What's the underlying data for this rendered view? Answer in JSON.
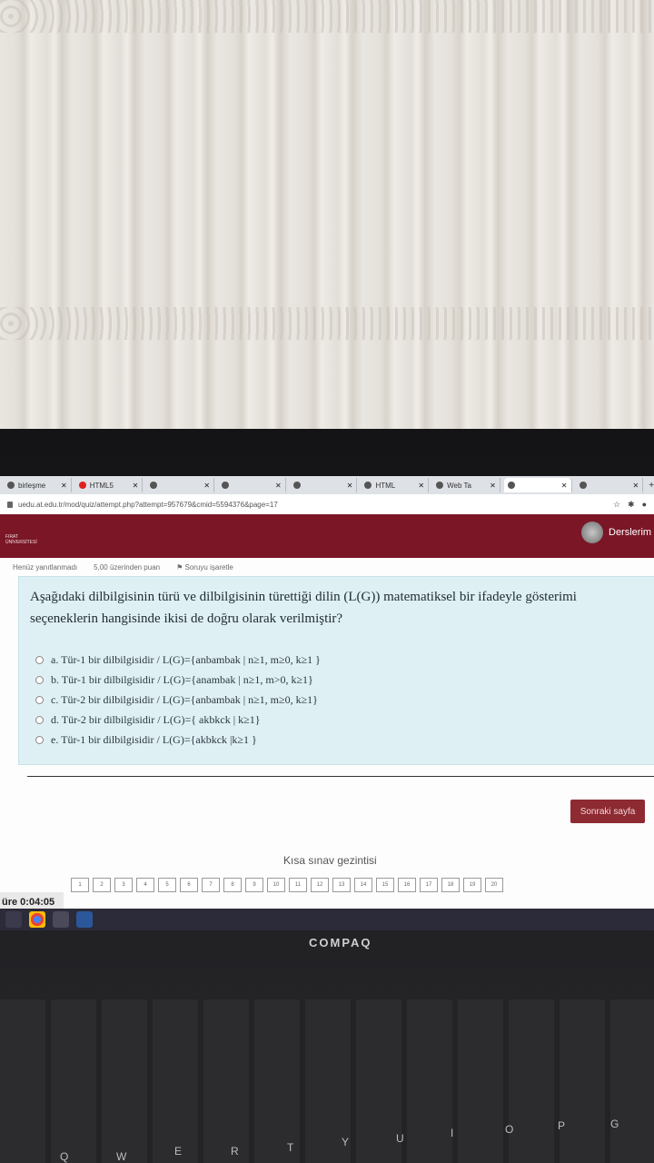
{
  "browser": {
    "tabs": [
      {
        "label": "birleşme",
        "active": false
      },
      {
        "label": "HTML5",
        "active": false
      },
      {
        "label": "",
        "active": false
      },
      {
        "label": "",
        "active": false
      },
      {
        "label": "",
        "active": false
      },
      {
        "label": "HTML",
        "active": false
      },
      {
        "label": "Web Ta",
        "active": false
      },
      {
        "label": "",
        "active": true
      },
      {
        "label": "",
        "active": false
      }
    ],
    "url": "uedu.at.edu.tr/mod/quiz/attempt.php?attempt=957679&cmid=5594376&page=17"
  },
  "header": {
    "courses_label": "Derslerim"
  },
  "info": {
    "status": "Henüz yanıtlanmadı",
    "points": "5,00 üzerinden puan",
    "flag": "Soruyu işaretle"
  },
  "question": {
    "text": "Aşağıdaki dilbilgisinin türü ve dilbilgisinin türettiği dilin (L(G)) matematiksel bir ifadeyle gösterimi seçeneklerin hangisinde ikisi de doğru olarak verilmiştir?",
    "options": [
      "a. Tür-1 bir dilbilgisidir /  L(G)={anbambak | n≥1, m≥0, k≥1 }",
      "b. Tür-1 bir dilbilgisidir /  L(G)={anambak | n≥1, m>0, k≥1}",
      "c. Tür-2 bir dilbilgisidir /  L(G)={anbambak | n≥1, m≥0, k≥1}",
      "d. Tür-2 bir dilbilgisidir /  L(G)={ akbkck | k≥1}",
      "e. Tür-1 bir dilbilgisidir /  L(G)={akbkck |k≥1 }"
    ]
  },
  "next_button": "Sonraki sayfa",
  "navigation": {
    "title": "Kısa sınav gezintisi",
    "timer": "üre 0:04:05",
    "boxes": [
      "1",
      "2",
      "3",
      "4",
      "5",
      "6",
      "7",
      "8",
      "9",
      "10",
      "11",
      "12",
      "13",
      "14",
      "15",
      "16",
      "17",
      "18",
      "19",
      "20"
    ]
  },
  "brand": "COMPAQ",
  "keyboard_keys": [
    "Q",
    "W",
    "E",
    "R",
    "T",
    "Y",
    "U",
    "I",
    "O",
    "P",
    "G"
  ]
}
